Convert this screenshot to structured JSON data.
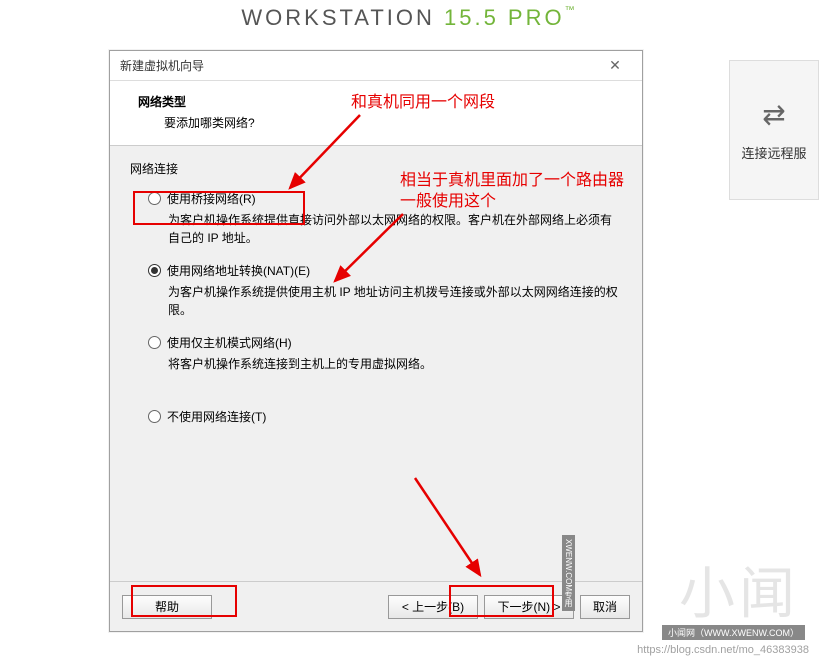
{
  "background": {
    "product_prefix": "WORKSTATION ",
    "product_version": "15.5 PRO",
    "right_panel_label": "连接远程服"
  },
  "dialog": {
    "title": "新建虚拟机向导",
    "header_title": "网络类型",
    "header_sub": "要添加哪类网络?",
    "group_label": "网络连接",
    "radios": [
      {
        "label": "使用桥接网络(R)",
        "desc": "为客户机操作系统提供直接访问外部以太网网络的权限。客户机在外部网络上必须有自己的 IP 地址。"
      },
      {
        "label": "使用网络地址转换(NAT)(E)",
        "desc": "为客户机操作系统提供使用主机 IP 地址访问主机拨号连接或外部以太网网络连接的权限。"
      },
      {
        "label": "使用仅主机模式网络(H)",
        "desc": "将客户机操作系统连接到主机上的专用虚拟网络。"
      },
      {
        "label": "不使用网络连接(T)",
        "desc": ""
      }
    ],
    "selected_index": 1,
    "footer": {
      "help": "帮助",
      "back": "< 上一步(B)",
      "next": "下一步(N) >",
      "cancel": "取消"
    }
  },
  "annotations": {
    "anno1": "和真机同用一个网段",
    "anno2_line1": "相当于真机里面加了一个路由器",
    "anno2_line2": "一般使用这个"
  },
  "watermark": {
    "text": "小闻",
    "bar": "小闻网（WWW.XWENW.COM）",
    "vertical": "XWENW.COM专用"
  },
  "blog_url": "https://blog.csdn.net/mo_46383938",
  "colors": {
    "annotation": "#e60000",
    "accent_green": "#73b53a"
  }
}
